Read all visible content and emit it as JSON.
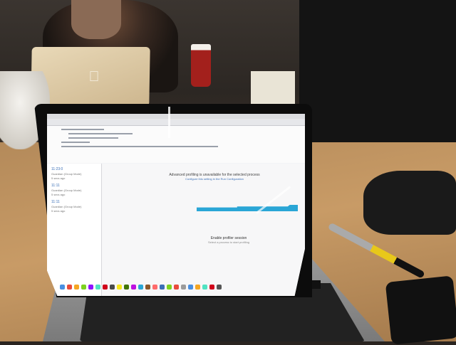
{
  "scene": {
    "background_logo": "apple-logo-icon"
  },
  "screen": {
    "menu_items": [
      "Android Studio",
      "File",
      "Edit",
      "View",
      "Navigate",
      "Code",
      "Analyze",
      "Refactor",
      "Build",
      "Run",
      "Tools",
      "VCS",
      "Window",
      "Help"
    ],
    "sidebar": [
      {
        "time": "11:23:0",
        "title": "Guardian (Group Mode)",
        "sub": "5 secs ago"
      },
      {
        "time": "11:11",
        "title": "Guardian (Group Mode)",
        "sub": "5 secs ago"
      },
      {
        "time": "11:11",
        "title": "Guardian (Group Mode)",
        "sub": "5 secs ago"
      }
    ],
    "message": "Advanced profiling is unavailable for the selected process",
    "message_link": "Configure this setting in the Run Configuration",
    "enable_title": "Enable profiler session",
    "enable_sub": "Select a process to start profiling"
  },
  "colors": {
    "chart_bar": "#2aa6d6",
    "desk": "#c89b66"
  }
}
